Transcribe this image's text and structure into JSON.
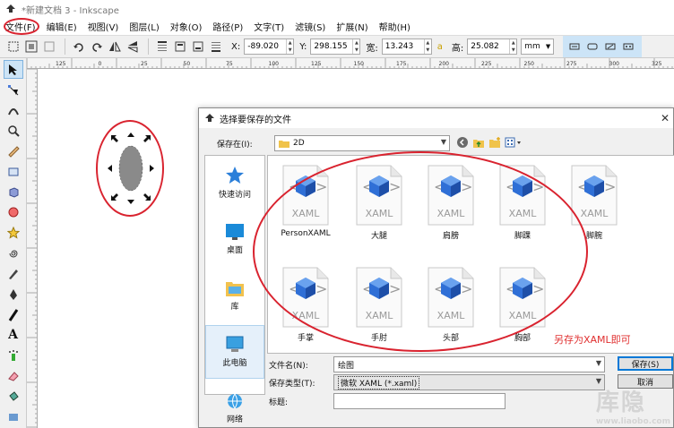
{
  "window": {
    "title": "*新建文档 3 - Inkscape"
  },
  "menubar": {
    "items": [
      "文件(F)",
      "编辑(E)",
      "视图(V)",
      "图层(L)",
      "对象(O)",
      "路径(P)",
      "文字(T)",
      "滤镜(S)",
      "扩展(N)",
      "帮助(H)"
    ]
  },
  "toolbar": {
    "x_label": "X:",
    "x_value": "-89.020",
    "y_label": "Y:",
    "y_value": "298.155",
    "w_label": "宽:",
    "w_value": "13.243",
    "h_label": "高:",
    "h_value": "25.082",
    "unit": "mm"
  },
  "ruler": {
    "ticks": [
      "125",
      "0",
      "25",
      "50",
      "75",
      "100",
      "125",
      "150",
      "175",
      "200",
      "225",
      "250",
      "275",
      "300",
      "325",
      "350"
    ]
  },
  "dialog": {
    "title": "选择要保存的文件",
    "save_in_label": "保存在(I):",
    "save_in_value": "2D",
    "places": [
      {
        "label": "快速访问",
        "icon": "star-icon"
      },
      {
        "label": "桌面",
        "icon": "desktop-icon"
      },
      {
        "label": "库",
        "icon": "library-icon"
      },
      {
        "label": "此电脑",
        "icon": "computer-icon"
      },
      {
        "label": "网络",
        "icon": "network-icon"
      }
    ],
    "file_type_label": "XAML",
    "files": [
      "PersonXAML",
      "大腿",
      "肩膀",
      "脚踝",
      "脚腕",
      "手掌",
      "手肘",
      "头部",
      "胸部"
    ],
    "filename_label": "文件名(N):",
    "filename_value": "绘图",
    "filetype_label": "保存类型(T):",
    "filetype_value": "微软 XAML (*.xaml)",
    "title_field_label": "标题:",
    "title_field_value": "",
    "save_button": "保存(S)",
    "cancel_button": "取消"
  },
  "annotation": "另存为XAML即可",
  "colors": {
    "annotation": "#d9232f",
    "xaml_blue": "#2f6fd6"
  },
  "watermark": {
    "main": "库隐",
    "sub": "www.liaobo.com"
  }
}
